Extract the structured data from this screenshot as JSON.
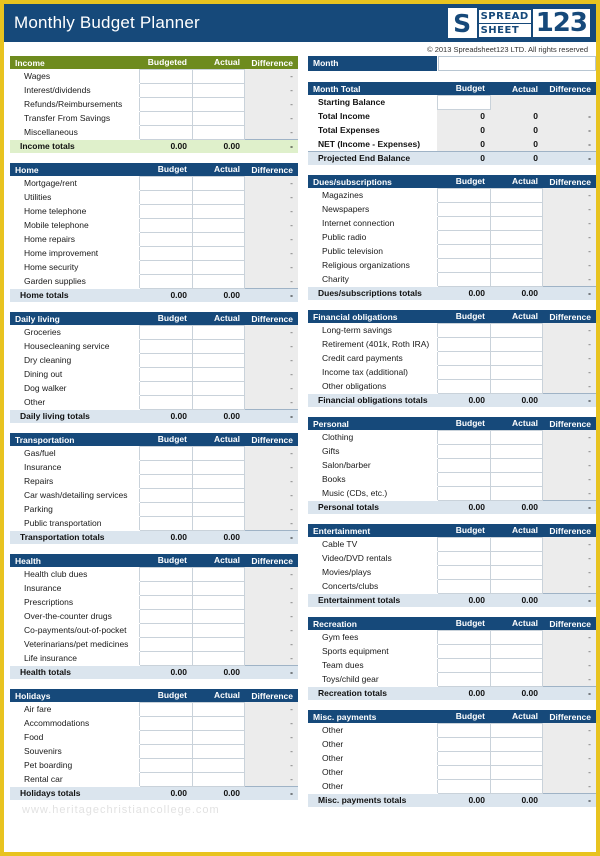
{
  "header": {
    "title": "Monthly Budget Planner",
    "logo": {
      "mark": "S",
      "word_top": "SPREAD",
      "word_bottom": "SHEET",
      "number": "123"
    },
    "copyright": "© 2013 Spreadsheet123 LTD. All rights reserved"
  },
  "month_selector": {
    "label": "Month",
    "value": "",
    "placeholder": ""
  },
  "columns": {
    "budget": "Budget",
    "budgeted": "Budgeted",
    "actual": "Actual",
    "difference": "Difference"
  },
  "colors": {
    "header_blue": "#16497a",
    "header_green": "#6e8b1e",
    "border_gold": "#e8c31f",
    "totals_blue": "#dbe5ee",
    "totals_green": "#dff0cb",
    "difference_cell": "#ececec"
  },
  "placeholder_dash": "-",
  "zero_decimal": "0.00",
  "zero_int": "0",
  "watermark": "www.heritagechristiancollege.com",
  "left_sections": [
    {
      "title": "Income",
      "accent": "green",
      "budget_header": "Budgeted",
      "items": [
        "Wages",
        "Interest/dividends",
        "Refunds/Reimbursements",
        "Transfer From Savings",
        "Miscellaneous"
      ],
      "totals_label": "Income totals",
      "totals_budget": "0.00",
      "totals_actual": "0.00",
      "totals_difference": "-"
    },
    {
      "title": "Home",
      "accent": "blue",
      "budget_header": "Budget",
      "items": [
        "Mortgage/rent",
        "Utilities",
        "Home telephone",
        "Mobile telephone",
        "Home repairs",
        "Home improvement",
        "Home security",
        "Garden supplies"
      ],
      "totals_label": "Home totals",
      "totals_budget": "0.00",
      "totals_actual": "0.00",
      "totals_difference": "-"
    },
    {
      "title": "Daily living",
      "accent": "blue",
      "budget_header": "Budget",
      "items": [
        "Groceries",
        "Housecleaning service",
        "Dry cleaning",
        "Dining out",
        "Dog walker",
        "Other"
      ],
      "totals_label": "Daily living totals",
      "totals_budget": "0.00",
      "totals_actual": "0.00",
      "totals_difference": "-"
    },
    {
      "title": "Transportation",
      "accent": "blue",
      "budget_header": "Budget",
      "items": [
        "Gas/fuel",
        "Insurance",
        "Repairs",
        "Car wash/detailing services",
        "Parking",
        "Public transportation"
      ],
      "totals_label": "Transportation totals",
      "totals_budget": "0.00",
      "totals_actual": "0.00",
      "totals_difference": "-"
    },
    {
      "title": "Health",
      "accent": "blue",
      "budget_header": "Budget",
      "items": [
        "Health club dues",
        "Insurance",
        "Prescriptions",
        "Over-the-counter drugs",
        "Co-payments/out-of-pocket",
        "Veterinarians/pet medicines",
        "Life insurance"
      ],
      "totals_label": "Health totals",
      "totals_budget": "0.00",
      "totals_actual": "0.00",
      "totals_difference": "-"
    },
    {
      "title": "Holidays",
      "accent": "blue",
      "budget_header": "Budget",
      "items": [
        "Air fare",
        "Accommodations",
        "Food",
        "Souvenirs",
        "Pet boarding",
        "Rental car"
      ],
      "totals_label": "Holidays totals",
      "totals_budget": "0.00",
      "totals_actual": "0.00",
      "totals_difference": "-"
    }
  ],
  "month_total": {
    "title": "Month Total",
    "budget_header": "Budget",
    "rows": [
      {
        "label": "Starting Balance",
        "budget": "",
        "actual": "",
        "difference": "",
        "input": true
      },
      {
        "label": "Total Income",
        "budget": "0",
        "actual": "0",
        "difference": "-",
        "input": false
      },
      {
        "label": "Total Expenses",
        "budget": "0",
        "actual": "0",
        "difference": "-",
        "input": false
      },
      {
        "label": "NET (Income - Expenses)",
        "budget": "0",
        "actual": "0",
        "difference": "-",
        "input": false
      }
    ],
    "final": {
      "label": "Projected End Balance",
      "budget": "0",
      "actual": "0",
      "difference": "-"
    }
  },
  "right_sections": [
    {
      "title": "Dues/subscriptions",
      "accent": "blue",
      "budget_header": "Budget",
      "items": [
        "Magazines",
        "Newspapers",
        "Internet connection",
        "Public radio",
        "Public television",
        "Religious organizations",
        "Charity"
      ],
      "totals_label": "Dues/subscriptions totals",
      "totals_budget": "0.00",
      "totals_actual": "0.00",
      "totals_difference": "-"
    },
    {
      "title": "Financial obligations",
      "accent": "blue",
      "budget_header": "Budget",
      "items": [
        "Long-term savings",
        "Retirement (401k, Roth IRA)",
        "Credit card payments",
        "Income tax (additional)",
        "Other obligations"
      ],
      "totals_label": "Financial obligations totals",
      "totals_budget": "0.00",
      "totals_actual": "0.00",
      "totals_difference": "-"
    },
    {
      "title": "Personal",
      "accent": "blue",
      "budget_header": "Budget",
      "items": [
        "Clothing",
        "Gifts",
        "Salon/barber",
        "Books",
        "Music (CDs, etc.)"
      ],
      "totals_label": "Personal totals",
      "totals_budget": "0.00",
      "totals_actual": "0.00",
      "totals_difference": "-"
    },
    {
      "title": "Entertainment",
      "accent": "blue",
      "budget_header": "Budget",
      "items": [
        "Cable TV",
        "Video/DVD rentals",
        "Movies/plays",
        "Concerts/clubs"
      ],
      "totals_label": "Entertainment totals",
      "totals_budget": "0.00",
      "totals_actual": "0.00",
      "totals_difference": "-"
    },
    {
      "title": "Recreation",
      "accent": "blue",
      "budget_header": "Budget",
      "items": [
        "Gym fees",
        "Sports equipment",
        "Team dues",
        "Toys/child gear"
      ],
      "totals_label": "Recreation totals",
      "totals_budget": "0.00",
      "totals_actual": "0.00",
      "totals_difference": "-"
    },
    {
      "title": "Misc. payments",
      "accent": "blue",
      "budget_header": "Budget",
      "items": [
        "Other",
        "Other",
        "Other",
        "Other",
        "Other"
      ],
      "totals_label": "Misc. payments totals",
      "totals_budget": "0.00",
      "totals_actual": "0.00",
      "totals_difference": "-"
    }
  ]
}
